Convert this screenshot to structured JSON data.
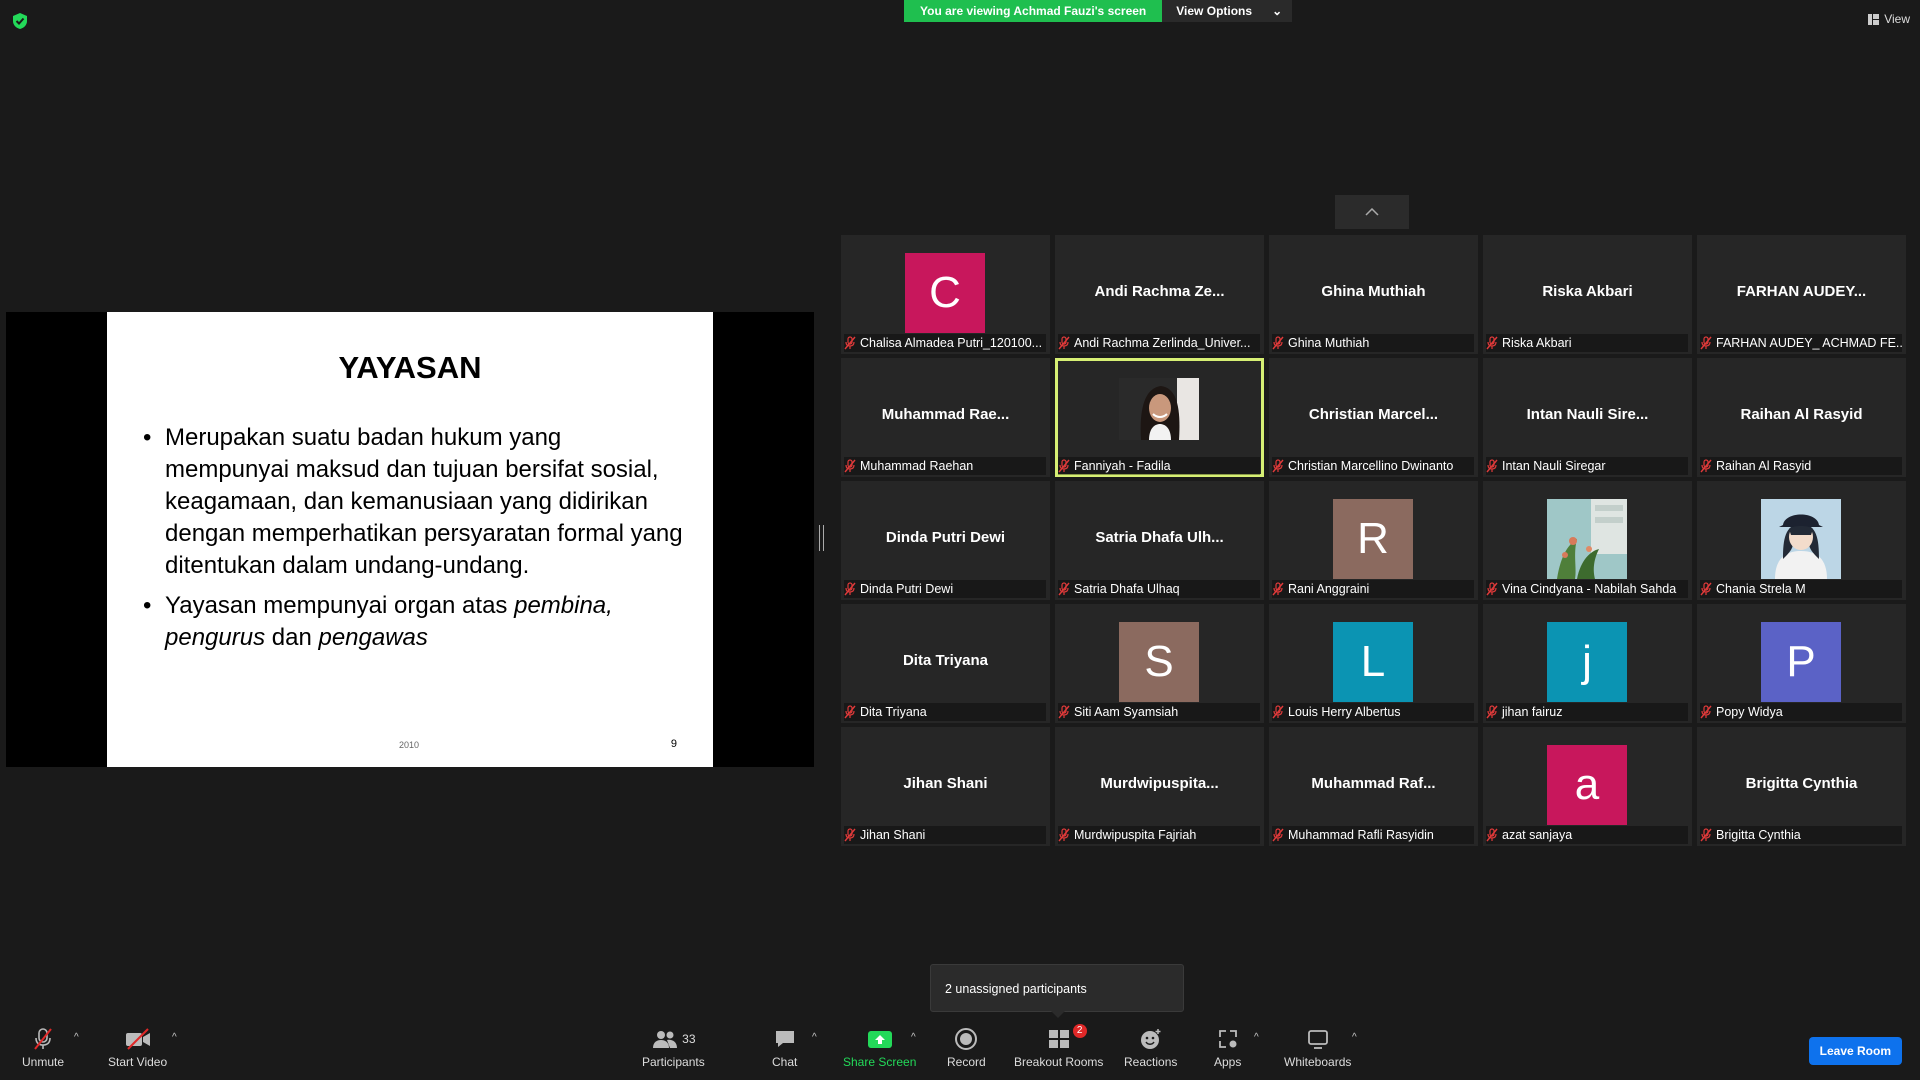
{
  "header": {
    "viewing_banner": "You are viewing Achmad Fauzi's screen",
    "view_options_label": "View Options",
    "view_label": "View"
  },
  "slide": {
    "title": "YAYASAN",
    "bullet1": "Merupakan suatu badan hukum yang mempunyai maksud dan tujuan bersifat sosial, keagamaan, dan kemanusiaan yang didirikan dengan memperhatikan persyaratan formal yang ditentukan dalam undang-undang.",
    "bullet2_a": "Yayasan mempunyai organ atas ",
    "bullet2_b": "pembina, pengurus",
    "bullet2_c": " dan ",
    "bullet2_d": "pengawas",
    "footer_left": "2010",
    "page_number": "9"
  },
  "participants": [
    {
      "display": "avatar",
      "initial": "C",
      "color": "#c8175c",
      "label": "Chalisa Almadea Putri_120100..."
    },
    {
      "display": "name",
      "name": "Andi Rachma Ze...",
      "label": "Andi Rachma Zerlinda_Univer..."
    },
    {
      "display": "name",
      "name": "Ghina Muthiah",
      "label": "Ghina Muthiah"
    },
    {
      "display": "name",
      "name": "Riska Akbari",
      "label": "Riska Akbari"
    },
    {
      "display": "name",
      "name": "FARHAN AUDEY...",
      "label": "FARHAN AUDEY_ ACHMAD FE..."
    },
    {
      "display": "name",
      "name": "Muhammad Rae...",
      "label": "Muhammad Raehan"
    },
    {
      "display": "video",
      "label": "Fanniyah - Fadila",
      "active": true
    },
    {
      "display": "name",
      "name": "Christian Marcel...",
      "label": "Christian Marcellino Dwinanto"
    },
    {
      "display": "name",
      "name": "Intan Nauli Sire...",
      "label": "Intan Nauli Siregar"
    },
    {
      "display": "name",
      "name": "Raihan Al Rasyid",
      "label": "Raihan Al Rasyid"
    },
    {
      "display": "name",
      "name": "Dinda Putri Dewi",
      "label": "Dinda Putri Dewi"
    },
    {
      "display": "name",
      "name": "Satria Dhafa Ulh...",
      "label": "Satria Dhafa Ulhaq"
    },
    {
      "display": "avatar",
      "initial": "R",
      "color": "#8b6a5f",
      "label": "Rani Anggraini"
    },
    {
      "display": "photo",
      "photo": "plant",
      "label": "Vina Cindyana - Nabilah Sahda"
    },
    {
      "display": "photo",
      "photo": "anime",
      "label": "Chania Strela M"
    },
    {
      "display": "name",
      "name": "Dita Triyana",
      "label": "Dita Triyana"
    },
    {
      "display": "avatar",
      "initial": "S",
      "color": "#8b6a5f",
      "label": "Siti Aam Syamsiah"
    },
    {
      "display": "avatar",
      "initial": "L",
      "color": "#0b94b3",
      "label": "Louis Herry Albertus"
    },
    {
      "display": "avatar",
      "initial": "j",
      "color": "#0b94b3",
      "label": "jihan fairuz"
    },
    {
      "display": "avatar",
      "initial": "P",
      "color": "#5b62c6",
      "label": "Popy Widya"
    },
    {
      "display": "name",
      "name": "Jihan Shani",
      "label": "Jihan Shani"
    },
    {
      "display": "name",
      "name": "Murdwipuspita...",
      "label": "Murdwipuspita Fajriah"
    },
    {
      "display": "name",
      "name": "Muhammad Raf...",
      "label": "Muhammad Rafli Rasyidin"
    },
    {
      "display": "avatar",
      "initial": "a",
      "color": "#c8175c",
      "label": "azat sanjaya"
    },
    {
      "display": "name",
      "name": "Brigitta Cynthia",
      "label": "Brigitta Cynthia"
    }
  ],
  "tooltip": {
    "text": "2 unassigned participants"
  },
  "toolbar": {
    "unmute": "Unmute",
    "start_video": "Start Video",
    "participants": "Participants",
    "participants_count": "33",
    "chat": "Chat",
    "share_screen": "Share Screen",
    "record": "Record",
    "breakout_rooms": "Breakout Rooms",
    "breakout_badge": "2",
    "reactions": "Reactions",
    "apps": "Apps",
    "whiteboards": "Whiteboards",
    "leave": "Leave Room"
  },
  "colors": {
    "share_green": "#23d959",
    "active_speaker": "#d6ef74",
    "leave_blue": "#0e72ed"
  }
}
